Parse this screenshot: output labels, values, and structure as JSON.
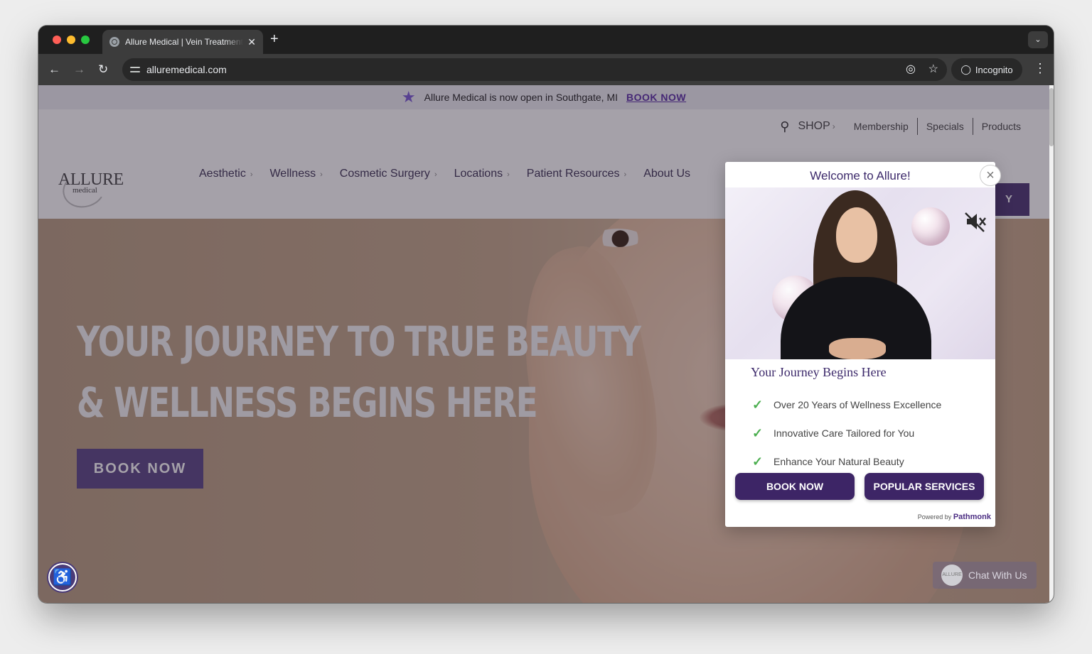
{
  "browser": {
    "tab_title": "Allure Medical | Vein Treatment",
    "tab_close": "✕",
    "new_tab": "+",
    "url": "alluremedical.com",
    "incognito_label": "Incognito"
  },
  "announcement": {
    "text": "Allure Medical is now open in Southgate, MI",
    "link": "BOOK NOW"
  },
  "utility_nav": {
    "shop": "SHOP",
    "links": [
      "Membership",
      "Specials",
      "Products"
    ]
  },
  "logo": {
    "wordmark": "ALLURE",
    "sub": "medical"
  },
  "main_nav": [
    "Aesthetic",
    "Wellness",
    "Cosmetic Surgery",
    "Locations",
    "Patient Resources",
    "About Us"
  ],
  "header_cta": {
    "partial_label": "Y"
  },
  "hero": {
    "line1": "YOUR JOURNEY TO TRUE BEAUTY",
    "line2": "& WELLNESS BEGINS HERE",
    "button": "BOOK NOW"
  },
  "chat": {
    "avatar_text": "ALLURE",
    "label": "Chat With Us"
  },
  "modal": {
    "title": "Welcome to Allure!",
    "subtitle": "Your Journey Begins Here",
    "benefits": [
      "Over 20 Years of Wellness Excellence",
      "Innovative Care Tailored for You",
      "Enhance Your Natural Beauty"
    ],
    "primary_button": "BOOK NOW",
    "secondary_button": "POPULAR SERVICES",
    "powered_by": "Powered by",
    "powered_brand": "Pathmonk"
  },
  "colors": {
    "brand_purple": "#3d2566",
    "hero_button": "#5a4585",
    "check_green": "#4caf50"
  }
}
